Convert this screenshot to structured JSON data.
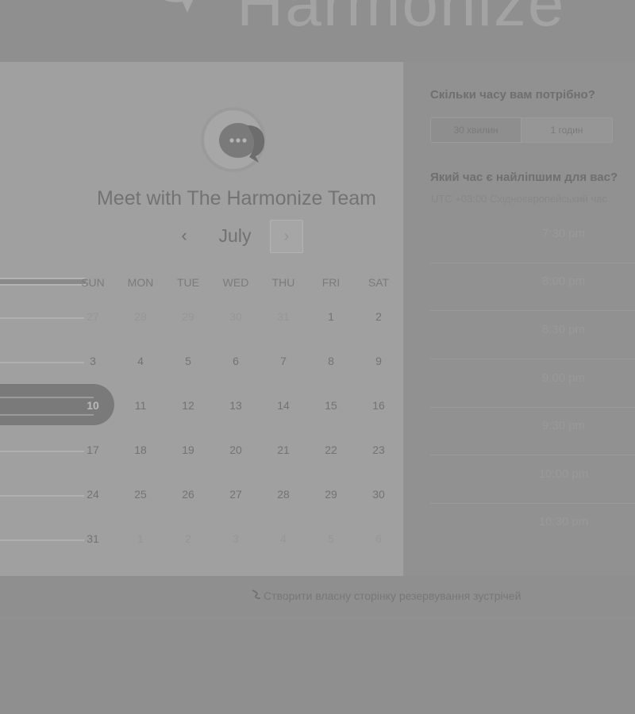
{
  "header": {
    "brand": "Harmonize",
    "logo": "chat-bubble-icon"
  },
  "calendar": {
    "title": "Meet with The Harmonize Team",
    "avatar_icon": "chat-bubble-icon",
    "month": "July",
    "prev_icon": "‹",
    "next_icon": "›",
    "weekdays": [
      "SUN",
      "MON",
      "TUE",
      "WED",
      "THU",
      "FRI",
      "SAT"
    ],
    "weeks": [
      [
        "27",
        "28",
        "29",
        "30",
        "31",
        "1",
        "2"
      ],
      [
        "3",
        "4",
        "5",
        "6",
        "7",
        "8",
        "9"
      ],
      [
        "10",
        "11",
        "12",
        "13",
        "14",
        "15",
        "16"
      ],
      [
        "17",
        "18",
        "19",
        "20",
        "21",
        "22",
        "23"
      ],
      [
        "24",
        "25",
        "26",
        "27",
        "28",
        "29",
        "30"
      ],
      [
        "31",
        "1",
        "2",
        "3",
        "4",
        "5",
        "6"
      ]
    ],
    "selected_day": "10"
  },
  "booking": {
    "duration_question": "Скільки часу вам потрібно?",
    "durations": [
      "30 хвилин",
      "1 годин"
    ],
    "time_question": "Який час є найліпшим для вас?",
    "timezone": "UTC +03:00 Східноєвропейський час",
    "slots": [
      "7:30 pm",
      "8:00 pm",
      "8:30 pm",
      "9:00 pm",
      "9:30 pm",
      "10:00 pm",
      "10:30 pm"
    ]
  },
  "footer": {
    "link_icon": "scribble-icon",
    "link_text": "Створити власну сторінку резервування зустрічей"
  },
  "colors": {
    "overlay": "#8f8f8f",
    "card": "#a0a0a0",
    "selected": "#7a7a7a"
  }
}
